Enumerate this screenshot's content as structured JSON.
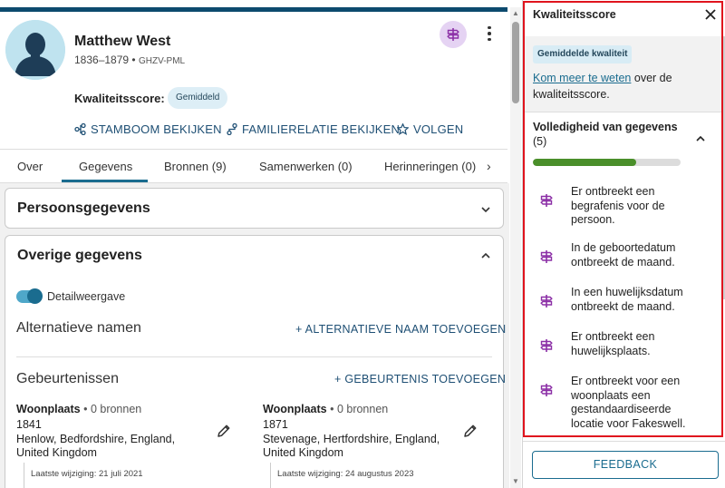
{
  "person": {
    "name": "Matthew West",
    "lifespan": "1836–1879",
    "separator": "•",
    "id": "GHZV-PML"
  },
  "quality": {
    "label": "Kwaliteitsscore:",
    "badge": "Gemiddeld"
  },
  "actions": [
    {
      "label": "STAMBOOM BEKIJKEN",
      "icon": "tree-icon"
    },
    {
      "label": "FAMILIERELATIE BEKIJKEN",
      "icon": "relationship-icon"
    },
    {
      "label": "VOLGEN",
      "icon": "star-icon"
    }
  ],
  "tabs": [
    {
      "label": "Over"
    },
    {
      "label": "Gegevens",
      "active": true
    },
    {
      "label": "Bronnen (9)"
    },
    {
      "label": "Samenwerken (0)"
    },
    {
      "label": "Herinneringen (0)"
    }
  ],
  "cards": {
    "personal": "Persoonsgegevens",
    "other": "Overige gegevens"
  },
  "detail_toggle": {
    "label": "Detailweergave",
    "on": true
  },
  "alt_names": {
    "title": "Alternatieve namen",
    "add": "+ ALTERNATIEVE NAAM TOEVOEGEN"
  },
  "events": {
    "title": "Gebeurtenissen",
    "add": "+ GEBEURTENIS TOEVOEGEN",
    "items": [
      {
        "type": "Woonplaats",
        "sources": "• 0 bronnen",
        "year": "1841",
        "place_line1": "Henlow, Bedfordshire, England,",
        "place_line2": "United Kingdom",
        "modified": "Laatste wijziging: 21 juli 2021"
      },
      {
        "type": "Woonplaats",
        "sources": "• 0 bronnen",
        "year": "1871",
        "place_line1": "Stevenage, Hertfordshire, England,",
        "place_line2": "United Kingdom",
        "modified": "Laatste wijziging: 24 augustus 2023"
      }
    ]
  },
  "panel": {
    "title": "Kwaliteitsscore",
    "badge": "Gemiddelde kwaliteit",
    "more_link": "Kom meer te weten",
    "more_rest": " over de kwaliteitsscore.",
    "section_title": "Volledigheid van gegevens",
    "section_count": "(5)",
    "completeness": 0.7,
    "items": [
      {
        "text": "Er ontbreekt een begrafenis voor de persoon."
      },
      {
        "text": "In de geboortedatum ontbreekt de maand."
      },
      {
        "text": "In een huwelijksdatum ontbreekt de maand."
      },
      {
        "text": "Er ontbreekt een huwelijksplaats."
      },
      {
        "text": "Er ontbreekt voor een woonplaats een gestandaardiseerde locatie voor Fakeswell."
      }
    ],
    "feedback": "FEEDBACK"
  },
  "colors": {
    "accent": "#1a6c8f",
    "brand_bar": "#0c4a6e",
    "hint": "#8b2fa6",
    "progress": "#4a8f2a",
    "highlight": "#e0141e"
  }
}
